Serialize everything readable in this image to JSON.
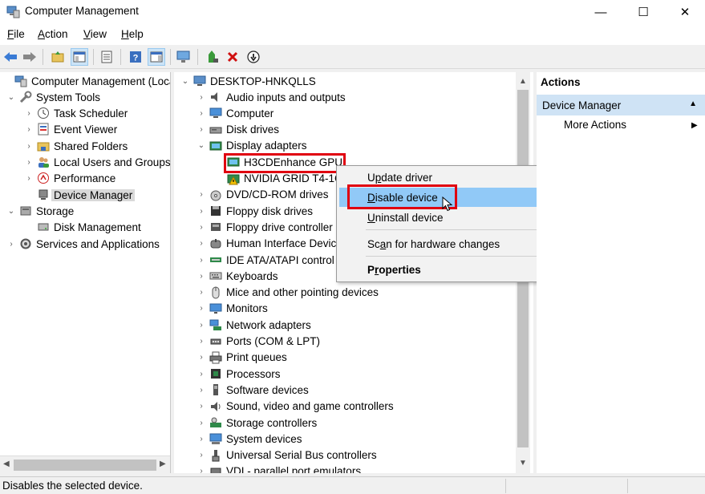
{
  "window": {
    "title": "Computer Management",
    "min": "—",
    "max": "☐",
    "close": "✕"
  },
  "menu": [
    {
      "label": "File",
      "key": "F",
      "rest": "ile"
    },
    {
      "label": "Action",
      "key": "A",
      "rest": "ction"
    },
    {
      "label": "View",
      "key": "V",
      "rest": "iew"
    },
    {
      "label": "Help",
      "key": "H",
      "rest": "elp"
    }
  ],
  "left_tree": [
    {
      "label": "Computer Management (Local",
      "exp": "",
      "icon": "computer-management-icon"
    },
    {
      "label": "System Tools",
      "exp": "⌄",
      "icon": "system-tools-icon"
    },
    {
      "label": "Task Scheduler",
      "exp": "›",
      "icon": "task-scheduler-icon"
    },
    {
      "label": "Event Viewer",
      "exp": "›",
      "icon": "event-viewer-icon"
    },
    {
      "label": "Shared Folders",
      "exp": "›",
      "icon": "shared-folders-icon"
    },
    {
      "label": "Local Users and Groups",
      "exp": "›",
      "icon": "local-users-icon"
    },
    {
      "label": "Performance",
      "exp": "›",
      "icon": "performance-icon"
    },
    {
      "label": "Device Manager",
      "exp": "",
      "icon": "device-manager-icon"
    },
    {
      "label": "Storage",
      "exp": "⌄",
      "icon": "storage-icon"
    },
    {
      "label": "Disk Management",
      "exp": "",
      "icon": "disk-management-icon"
    },
    {
      "label": "Services and Applications",
      "exp": "›",
      "icon": "services-icon"
    }
  ],
  "device_tree": {
    "root": "DESKTOP-HNKQLLS",
    "items": [
      {
        "label": "Audio inputs and outputs",
        "exp": "›"
      },
      {
        "label": "Computer",
        "exp": "›"
      },
      {
        "label": "Disk drives",
        "exp": "›"
      },
      {
        "label": "Display adapters",
        "exp": "⌄"
      },
      {
        "label": "H3CDEnhance GPU",
        "exp": ""
      },
      {
        "label": "NVIDIA GRID T4-1C",
        "exp": ""
      },
      {
        "label": "DVD/CD-ROM drives",
        "exp": "›"
      },
      {
        "label": "Floppy disk drives",
        "exp": "›"
      },
      {
        "label": "Floppy drive controller",
        "exp": "›"
      },
      {
        "label": "Human Interface Devic",
        "exp": "›"
      },
      {
        "label": "IDE ATA/ATAPI control",
        "exp": "›"
      },
      {
        "label": "Keyboards",
        "exp": "›"
      },
      {
        "label": "Mice and other pointing devices",
        "exp": "›"
      },
      {
        "label": "Monitors",
        "exp": "›"
      },
      {
        "label": "Network adapters",
        "exp": "›"
      },
      {
        "label": "Ports (COM & LPT)",
        "exp": "›"
      },
      {
        "label": "Print queues",
        "exp": "›"
      },
      {
        "label": "Processors",
        "exp": "›"
      },
      {
        "label": "Software devices",
        "exp": "›"
      },
      {
        "label": "Sound, video and game controllers",
        "exp": "›"
      },
      {
        "label": "Storage controllers",
        "exp": "›"
      },
      {
        "label": "System devices",
        "exp": "›"
      },
      {
        "label": "Universal Serial Bus controllers",
        "exp": "›"
      },
      {
        "label": "VDI - parallel port emulators",
        "exp": "›"
      }
    ]
  },
  "context_menu": {
    "update": {
      "key": "p",
      "pre": "U",
      "post": "date driver"
    },
    "disable": {
      "key": "D",
      "pre": "",
      "post": "isable device"
    },
    "uninstall": {
      "key": "U",
      "pre": "",
      "post": "ninstall device"
    },
    "scan": {
      "key": "a",
      "pre": "Sc",
      "post": "n for hardware changes"
    },
    "properties": {
      "key": "r",
      "pre": "P",
      "post": "operties"
    }
  },
  "actions": {
    "header": "Actions",
    "section": "Device Manager",
    "more": "More Actions"
  },
  "status": {
    "text": "Disables the selected device."
  },
  "colors": {
    "highlight": "#e00010",
    "hover": "#91c9f7",
    "actions_section": "#cfe3f5"
  }
}
